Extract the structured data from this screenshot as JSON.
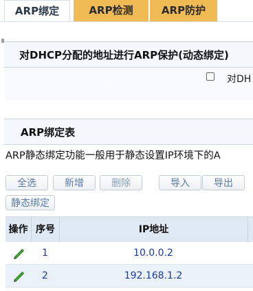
{
  "tabs": [
    {
      "label": "ARP绑定",
      "active": true
    },
    {
      "label": "ARP检测",
      "active": false
    },
    {
      "label": "ARP防护",
      "active": false
    }
  ],
  "dhcp_section": {
    "title": "对DHCP分配的地址进行ARP保护(动态绑定)",
    "checkbox_label": "对DH",
    "checkbox_checked": false
  },
  "binding_section": {
    "title": "ARP绑定表",
    "description": "ARP静态绑定功能一般用于静态设置IP环境下的A"
  },
  "toolbar": {
    "select_all": "全选",
    "add": "新增",
    "delete": "删除",
    "import": "导入",
    "export": "导出",
    "static_bind": "静态绑定"
  },
  "table": {
    "headers": {
      "op": "操作",
      "no": "序号",
      "ip": "IP地址"
    },
    "rows": [
      {
        "no": "1",
        "ip": "10.0.0.2"
      },
      {
        "no": "2",
        "ip": "192.168.1.2"
      }
    ]
  },
  "icons": {
    "edit": "pencil-edit-icon"
  },
  "colors": {
    "tab_inactive": "#f0bb54",
    "link_text": "#1a3aa0",
    "header_bg": "#dfe9f4"
  }
}
